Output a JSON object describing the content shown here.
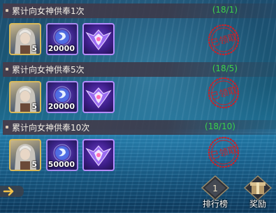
{
  "quests": [
    {
      "title": "累计向女神供奉1次",
      "progress": "(18/1)",
      "rewards": [
        {
          "type": "hero",
          "icon": "hero-portrait-icon",
          "qty": "5"
        },
        {
          "type": "gem",
          "icon": "crystal-currency-icon",
          "qty": "20000"
        },
        {
          "type": "badge",
          "icon": "shield-emblem-icon",
          "qty": ""
        }
      ],
      "status": "已领取"
    },
    {
      "title": "累计向女神供奉5次",
      "progress": "(18/5)",
      "rewards": [
        {
          "type": "hero",
          "icon": "hero-portrait-icon",
          "qty": "5"
        },
        {
          "type": "gem",
          "icon": "crystal-currency-icon",
          "qty": "20000"
        },
        {
          "type": "badge",
          "icon": "shield-emblem-icon",
          "qty": ""
        }
      ],
      "status": "已领取"
    },
    {
      "title": "累计向女神供奉10次",
      "progress": "(18/10)",
      "rewards": [
        {
          "type": "hero",
          "icon": "hero-portrait-icon",
          "qty": "5"
        },
        {
          "type": "gem",
          "icon": "crystal-currency-icon",
          "qty": "50000"
        },
        {
          "type": "badge",
          "icon": "shield-emblem-icon",
          "qty": ""
        }
      ],
      "status": "已领取"
    }
  ],
  "bottom_nav": {
    "back_icon": "back-arrow-icon",
    "ranking_label": "排行榜",
    "ranking_badge": "1",
    "reward_label": "奖励"
  },
  "colors": {
    "progress_complete": "#3bd14a",
    "stamp_red": "#c8222a",
    "hero_border": "#d8b95a"
  }
}
